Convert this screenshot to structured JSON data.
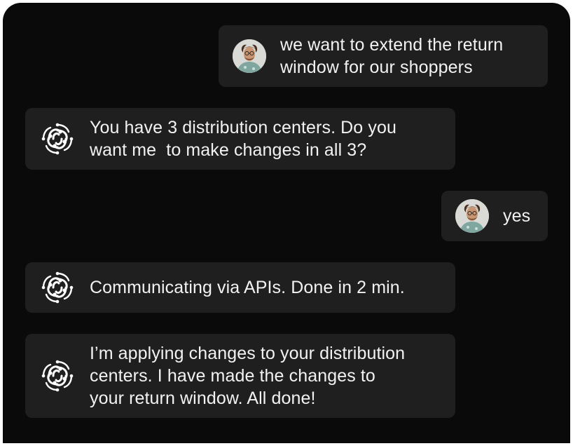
{
  "messages": [
    {
      "role": "user",
      "avatar_icon": "user-avatar-photo",
      "lines": [
        "we want to extend the return",
        "window for our shoppers"
      ]
    },
    {
      "role": "assistant",
      "avatar_icon": "assistant-logo-icon",
      "lines": [
        "You have 3 distribution centers. Do you",
        "want me  to make changes in all 3?"
      ]
    },
    {
      "role": "user",
      "avatar_icon": "user-avatar-photo",
      "lines": [
        "yes"
      ]
    },
    {
      "role": "assistant",
      "avatar_icon": "assistant-logo-icon",
      "lines": [
        "Communicating via APIs. Done in 2 min."
      ]
    },
    {
      "role": "assistant",
      "avatar_icon": "assistant-logo-icon",
      "lines": [
        "I’m applying changes to your distribution",
        "centers. I have made the changes to",
        "your return window. All done!"
      ]
    }
  ],
  "colors": {
    "background": "#0a0a0a",
    "bubble": "#1f1f1f",
    "text": "#f2f2f2"
  }
}
